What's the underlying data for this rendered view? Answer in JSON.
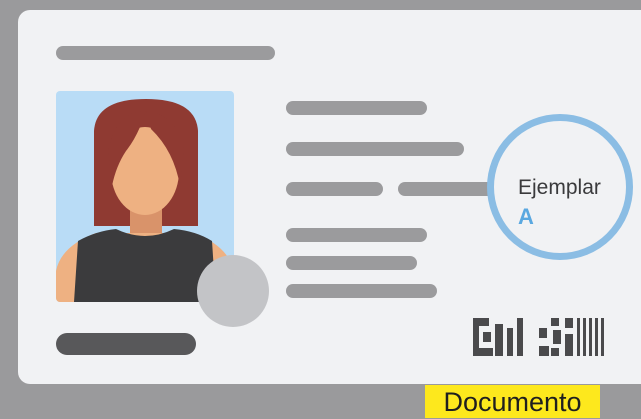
{
  "stamp": {
    "text": "Ejemplar",
    "letter": "A"
  },
  "caption": {
    "label": "Documento"
  },
  "colors": {
    "background": "#9a9a9c",
    "card": "#f1f2f4",
    "placeholder_bar": "#9b9b9d",
    "photo_bg": "#b9dcf6",
    "stamp_ring": "#8bbde4",
    "stamp_letter": "#5aa8e0",
    "label_bg": "#fde81d"
  }
}
